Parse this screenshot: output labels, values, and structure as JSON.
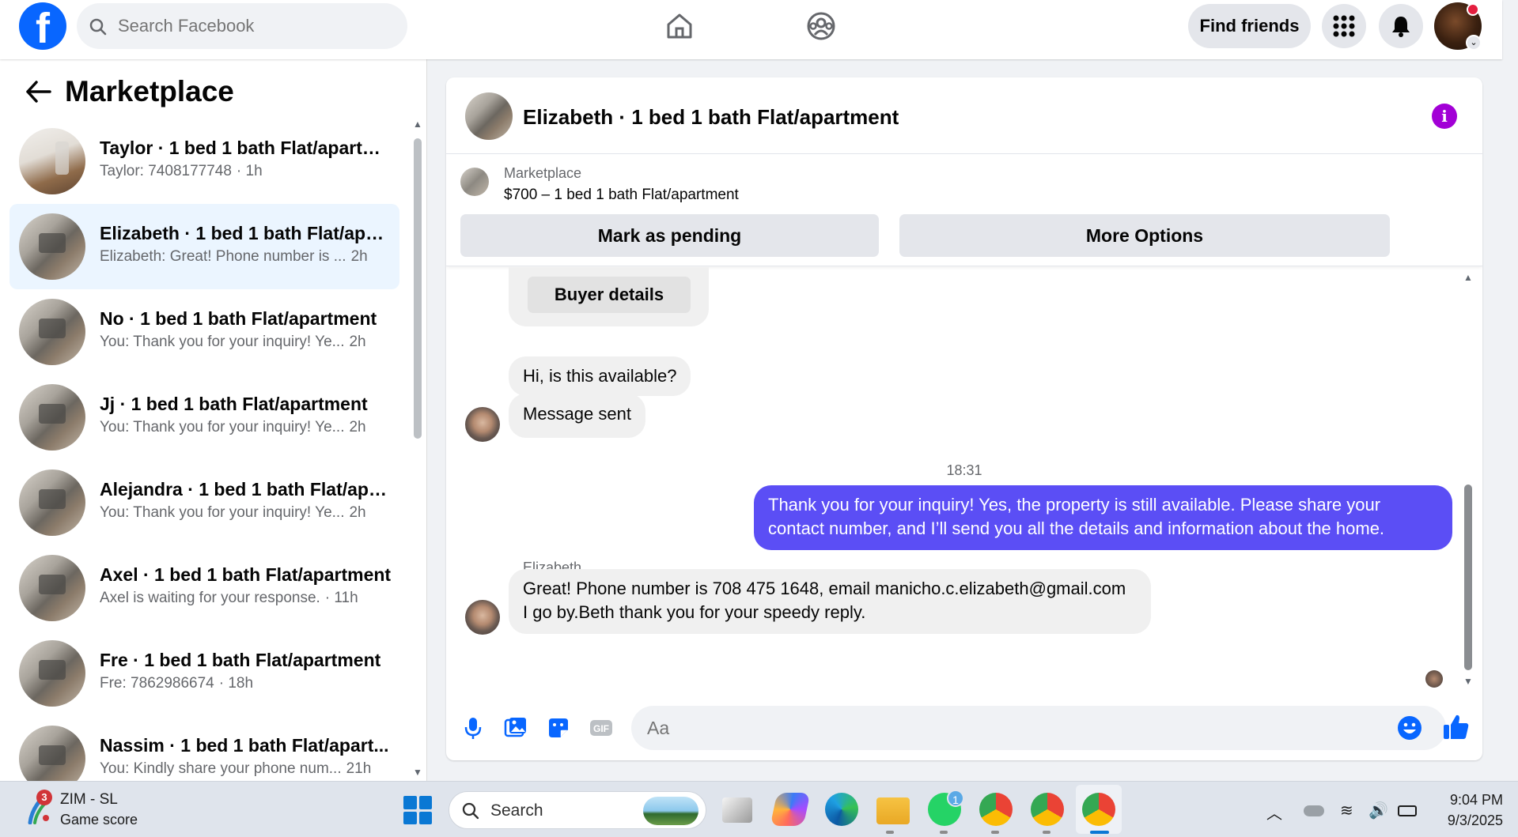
{
  "topbar": {
    "search_placeholder": "Search Facebook",
    "find_friends_label": "Find friends",
    "logo_letter": "f"
  },
  "sidebar": {
    "back_icon": "arrow-left-icon",
    "title": "Marketplace",
    "conversations": [
      {
        "title": "Taylor · 1 bed 1 bath Flat/apartm...",
        "subtitle": "Taylor: 7408177748",
        "time": "· 1h",
        "active": false
      },
      {
        "title": "Elizabeth · 1 bed 1 bath Flat/apar...",
        "subtitle": "Elizabeth: Great! Phone number is ...",
        "time": "2h",
        "active": true
      },
      {
        "title": "No · 1 bed 1 bath Flat/apartment",
        "subtitle": "You: Thank you for your inquiry! Ye...",
        "time": "2h",
        "active": false
      },
      {
        "title": "Jj · 1 bed 1 bath Flat/apartment",
        "subtitle": "You: Thank you for your inquiry! Ye...",
        "time": "2h",
        "active": false
      },
      {
        "title": "Alejandra · 1 bed 1 bath Flat/apa...",
        "subtitle": "You: Thank you for your inquiry! Ye...",
        "time": "2h",
        "active": false
      },
      {
        "title": "Axel · 1 bed 1 bath Flat/apartment",
        "subtitle": "Axel is waiting for your response.",
        "time": "· 11h",
        "active": false
      },
      {
        "title": "Fre · 1 bed 1 bath Flat/apartment",
        "subtitle": "Fre: 7862986674",
        "time": "· 18h",
        "active": false
      },
      {
        "title": "Nassim · 1 bed 1 bath Flat/apart...",
        "subtitle": "You: Kindly share your phone num...",
        "time": "21h",
        "active": false
      }
    ]
  },
  "chat": {
    "header_title": "Elizabeth · 1 bed 1 bath Flat/apartment",
    "info_icon": "info-icon",
    "listing_kicker": "Marketplace",
    "listing_price_title": "$700 – 1 bed 1 bath Flat/apartment",
    "mark_pending_label": "Mark as pending",
    "more_options_label": "More Options",
    "buyer_details_label": "Buyer details",
    "messages": {
      "m1": "Hi, is this available?",
      "m2": "Message sent",
      "time_separator": "18:31",
      "outgoing_line1": "Thank you for your inquiry! Yes, the property is still available. Please share your",
      "outgoing_line2": "contact number, and I’ll send you all the details and information about the home.",
      "sender_name": "Elizabeth",
      "incoming_line1": "Great! Phone number is 708 475 1648,  email manicho.c.elizabeth@gmail.com",
      "incoming_line2": "I go by.Beth thank you for your speedy reply."
    },
    "composer_placeholder": "Aa",
    "accent_color": "#5b4ef5"
  },
  "taskbar": {
    "widget_title": "ZIM - SL",
    "widget_subtitle": "Game score",
    "widget_badge": "3",
    "search_label": "Search",
    "whatsapp_badge": "1",
    "time": "9:04 PM",
    "date": "9/3/2025"
  }
}
